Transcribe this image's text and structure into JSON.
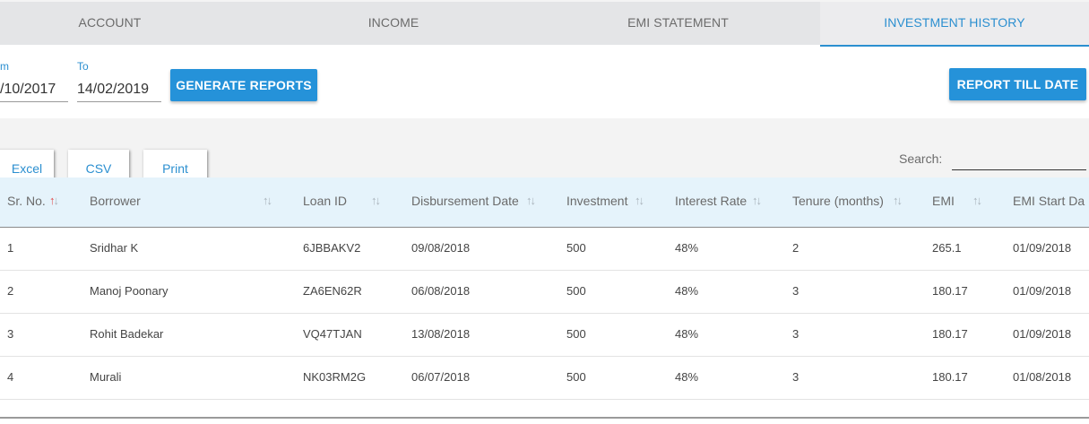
{
  "tabs": [
    {
      "label": "ACCOUNT"
    },
    {
      "label": "INCOME"
    },
    {
      "label": "EMI STATEMENT"
    },
    {
      "label": "INVESTMENT HISTORY",
      "active": true
    }
  ],
  "filters": {
    "from_label": "m",
    "from_value": "/10/2017",
    "to_label": "To",
    "to_value": "14/02/2019",
    "generate_label": "GENERATE REPORTS",
    "till_date_label": "REPORT TILL DATE"
  },
  "export": {
    "excel": "Excel",
    "csv": "CSV",
    "print": "Print"
  },
  "search": {
    "label": "Search:",
    "value": ""
  },
  "table": {
    "columns": [
      "Sr. No.",
      "Borrower",
      "Loan ID",
      "Disbursement Date",
      "Investment",
      "Interest Rate",
      "Tenure (months)",
      "EMI",
      "EMI Start Da"
    ],
    "sorted_column": "Sr. No.",
    "sort_direction": "ascending",
    "rows": [
      [
        "1",
        "Sridhar K",
        "6JBBAKV2",
        "09/08/2018",
        "500",
        "48%",
        "2",
        "265.1",
        "01/09/2018"
      ],
      [
        "2",
        "Manoj Poonary",
        "ZA6EN62R",
        "06/08/2018",
        "500",
        "48%",
        "3",
        "180.17",
        "01/09/2018"
      ],
      [
        "3",
        "Rohit Badekar",
        "VQ47TJAN",
        "13/08/2018",
        "500",
        "48%",
        "3",
        "180.17",
        "01/09/2018"
      ],
      [
        "4",
        "Murali",
        "NK03RM2G",
        "06/07/2018",
        "500",
        "48%",
        "3",
        "180.17",
        "01/08/2018"
      ]
    ]
  },
  "colors": {
    "accent": "#2592d9",
    "header_bg": "#e5f3fb",
    "sort_active": "#e34c4c"
  }
}
